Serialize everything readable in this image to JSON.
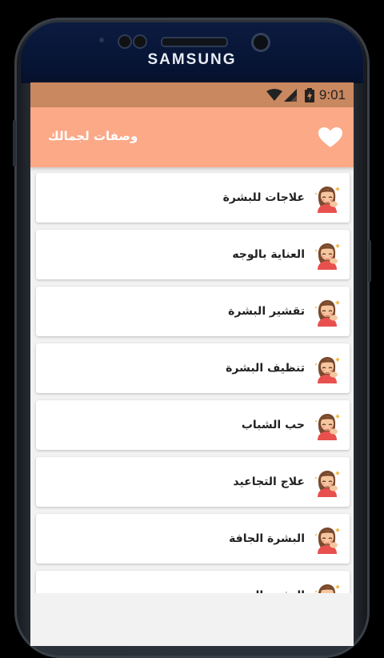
{
  "device": {
    "brand": "SAMSUNG"
  },
  "status_bar": {
    "time": "9:01",
    "icons": [
      "wifi-icon",
      "cell-signal-icon",
      "battery-icon"
    ]
  },
  "app_bar": {
    "title": "وصفات لجمالك",
    "action_icon": "heart-icon"
  },
  "colors": {
    "status_bar": "#c98860",
    "app_bar": "#fba987",
    "background": "#f2f2f2"
  },
  "list": {
    "items": [
      {
        "label": "علاجات للبشرة",
        "icon": "woman-face-icon"
      },
      {
        "label": "العناية بالوجه",
        "icon": "woman-face-icon"
      },
      {
        "label": "تقشير البشرة",
        "icon": "woman-face-icon"
      },
      {
        "label": "تنظيف البشرة",
        "icon": "woman-face-icon"
      },
      {
        "label": "حب الشباب",
        "icon": "woman-face-icon"
      },
      {
        "label": "علاج التجاعيد",
        "icon": "woman-face-icon"
      },
      {
        "label": "البشرة الجافة",
        "icon": "woman-face-icon"
      },
      {
        "label": "البشرة الدهنية",
        "icon": "woman-face-icon"
      }
    ]
  }
}
